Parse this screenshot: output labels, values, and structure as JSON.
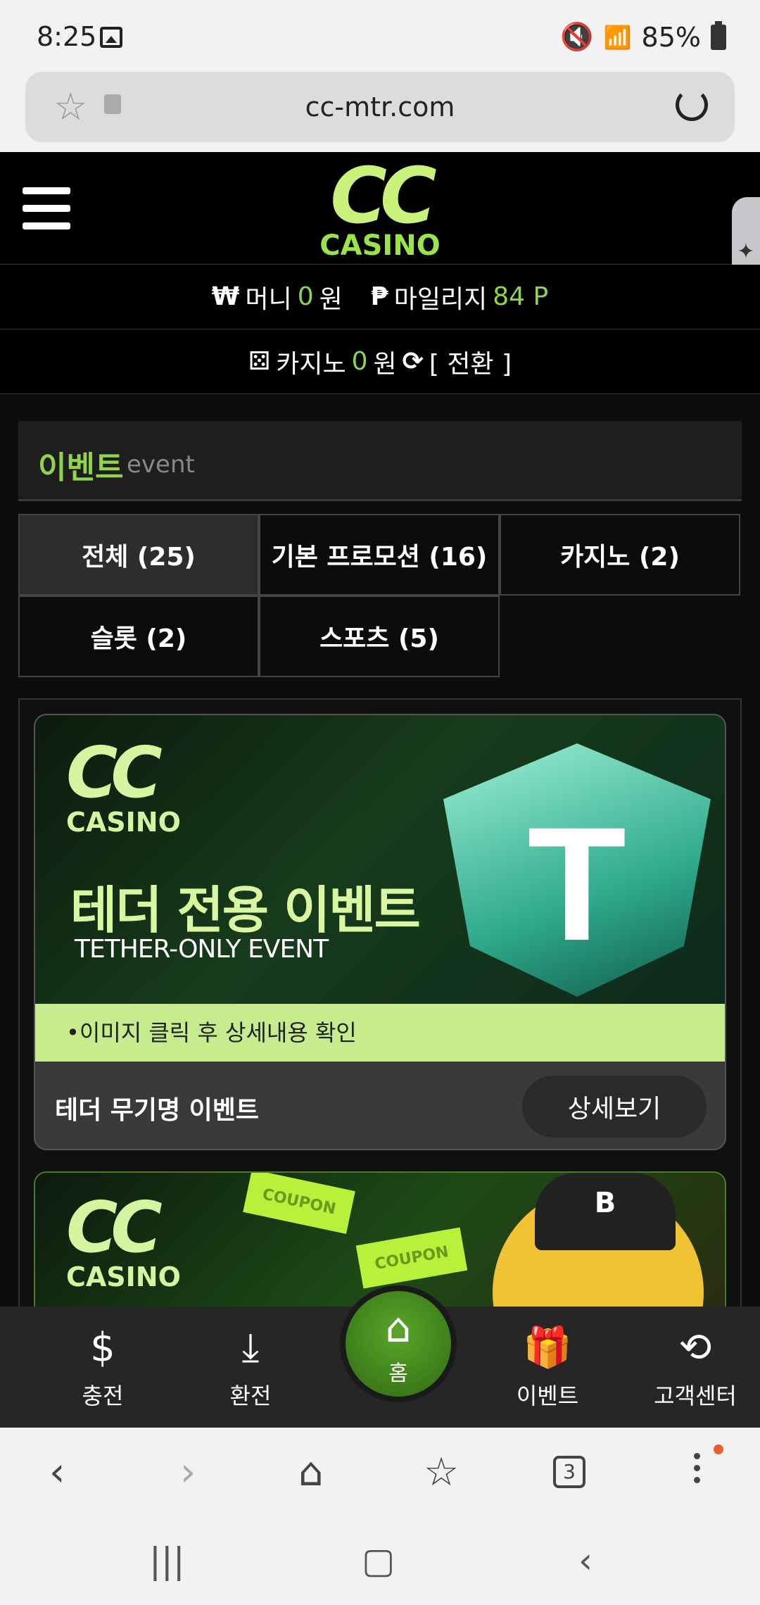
{
  "status_bar": {
    "time": "8:25",
    "battery": "85%",
    "icons": [
      "image-icon",
      "mute-icon",
      "wifi-icon",
      "hd-voice-icon",
      "signal-icon",
      "battery-icon"
    ]
  },
  "browser": {
    "url": "cc-mtr.com",
    "tab_count": "3"
  },
  "header": {
    "logo_top": "CC",
    "logo_bottom": "CASINO"
  },
  "balances": {
    "money_label": "머니",
    "money_value": "0",
    "money_unit": "원",
    "mileage_label": "마일리지",
    "mileage_value": "84 P",
    "casino_label": "카지노",
    "casino_value": "0",
    "casino_unit": "원",
    "switch_label": "[ 전환 ]"
  },
  "event_section": {
    "title_ko": "이벤트",
    "title_en": "event",
    "tabs": [
      {
        "label": "전체 (25)",
        "active": true
      },
      {
        "label": "기본 프로모션 (16)",
        "active": false
      },
      {
        "label": "카지노 (2)",
        "active": false
      },
      {
        "label": "슬롯 (2)",
        "active": false
      },
      {
        "label": "스포츠 (5)",
        "active": false
      }
    ]
  },
  "events": [
    {
      "banner_logo_top": "CC",
      "banner_logo_bottom": "CASINO",
      "banner_title": "테더 전용 이벤트",
      "banner_subtitle": "TETHER-ONLY EVENT",
      "banner_icon": "T",
      "note": "•이미지 클릭 후 상세내용 확인",
      "name": "테더 무기명 이벤트",
      "button": "상세보기"
    },
    {
      "banner_logo_top": "CC",
      "banner_logo_bottom": "CASINO",
      "coupon_text": "COUPON",
      "cap_text": "B"
    }
  ],
  "bottom_nav": {
    "items": [
      {
        "label": "충전",
        "icon": "deposit-icon"
      },
      {
        "label": "환전",
        "icon": "withdraw-icon"
      },
      {
        "label": "홈",
        "icon": "home-icon"
      },
      {
        "label": "이벤트",
        "icon": "gift-icon"
      },
      {
        "label": "고객센터",
        "icon": "support-24-icon"
      }
    ]
  },
  "colors": {
    "accent_green": "#8fd44a",
    "note_bg": "#c7ec8e",
    "header_bg": "#000000"
  }
}
